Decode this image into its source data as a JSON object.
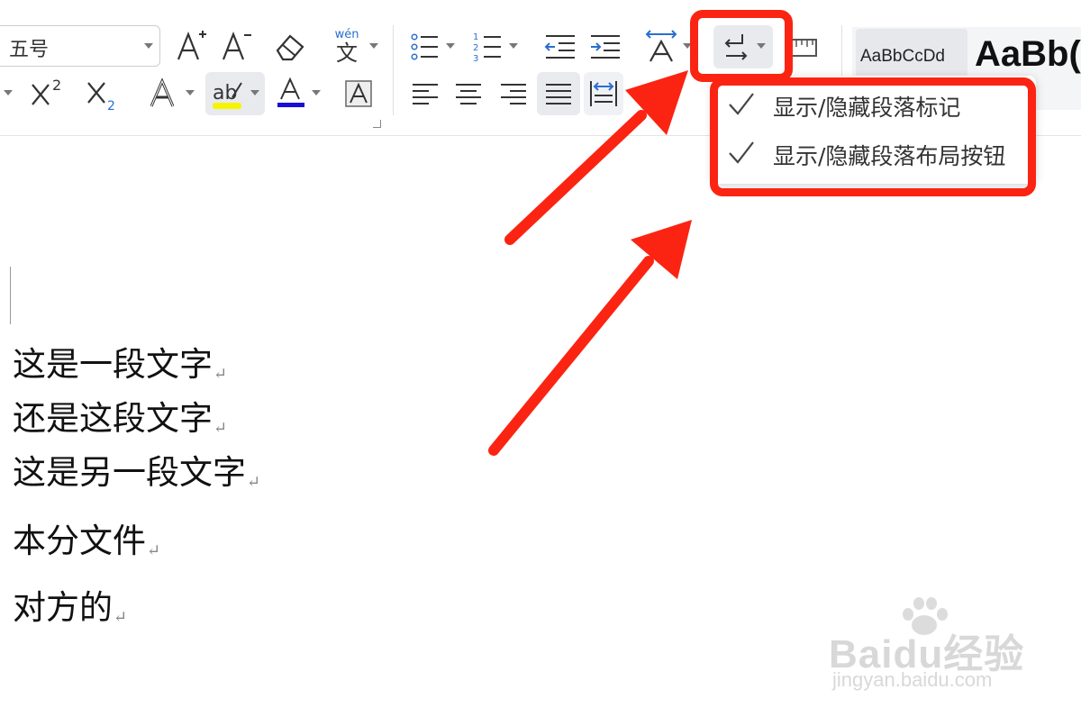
{
  "toolbar": {
    "font_size_value": "五号",
    "phonetic_label": "wén",
    "phonetic_char": "文",
    "superscript_label": "X²",
    "subscript_label": "X₂",
    "highlight_label": "ab",
    "font_color_label": "A",
    "char_shading_label": "A",
    "text_effect_label": "A",
    "grow_font_label": "A",
    "shrink_font_label": "A"
  },
  "styles": {
    "style1_label": "AaBbCcDd",
    "style2_label": "AaBb("
  },
  "dropdown": {
    "items": [
      {
        "label": "显示/隐藏段落标记",
        "checked": true
      },
      {
        "label": "显示/隐藏段落布局按钮",
        "checked": true
      }
    ]
  },
  "document": {
    "paragraphs": [
      "这是一段文字",
      "还是这段文字",
      "这是另一段文字",
      "本分文件",
      "对方的"
    ],
    "paragraph_mark": "↵"
  },
  "watermark": {
    "logo": "Baidu经验",
    "url": "jingyan.baidu.com"
  },
  "colors": {
    "annotation_red": "#fb2412",
    "highlight_yellow": "#f5f500",
    "font_color_blue": "#1a0dd6"
  }
}
